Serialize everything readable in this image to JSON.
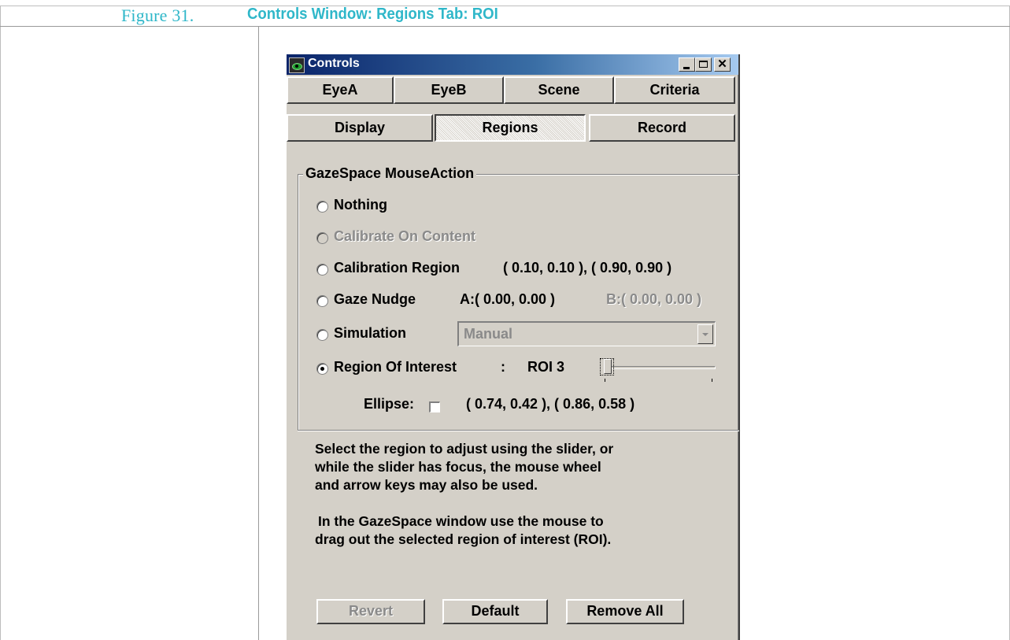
{
  "figure": {
    "number": "Figure 31.",
    "title": "Controls Window: Regions Tab: ROI"
  },
  "window": {
    "title": "Controls"
  },
  "tabs_row1": [
    "EyeA",
    "EyeB",
    "Scene",
    "Criteria"
  ],
  "tabs_row2": [
    "Display",
    "Regions",
    "Record"
  ],
  "active_tab": "Regions",
  "group": {
    "title": "GazeSpace MouseAction",
    "options": {
      "nothing": "Nothing",
      "calibrate_on_content": "Calibrate On Content",
      "calibration_region": "Calibration Region",
      "calibration_region_value": "( 0.10, 0.10 ), ( 0.90, 0.90 )",
      "gaze_nudge": "Gaze Nudge",
      "gaze_nudge_a": "A:( 0.00,  0.00 )",
      "gaze_nudge_b": "B:( 0.00,  0.00 )",
      "simulation": "Simulation",
      "simulation_value": "Manual",
      "roi": "Region Of Interest",
      "roi_sep": ":",
      "roi_value": "ROI 3"
    },
    "selected": "Region Of Interest",
    "ellipse_label": "Ellipse:",
    "ellipse_checked": false,
    "roi_coords": "( 0.74, 0.42 ), ( 0.86, 0.58 )"
  },
  "help": {
    "line1": "Select the region to adjust using the slider, or",
    "line2": "while the slider has focus, the mouse wheel",
    "line3": "and arrow keys may also be used.",
    "line4": "In the GazeSpace window use the mouse to",
    "line5": "drag out the selected region of interest (ROI)."
  },
  "buttons": {
    "revert": "Revert",
    "default": "Default",
    "remove_all": "Remove All"
  },
  "colors": {
    "accent": "#2fb7c9",
    "face": "#d4d0c8",
    "titlebar": "#0a246a"
  },
  "icons": [
    "app-eye-icon",
    "minimize-icon",
    "maximize-icon",
    "close-icon",
    "chevron-down-icon"
  ]
}
